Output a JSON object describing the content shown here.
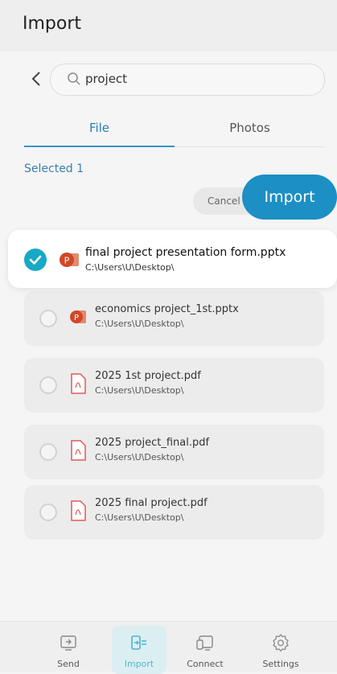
{
  "header": {
    "title": "Import"
  },
  "search": {
    "query": "project"
  },
  "tabs": [
    {
      "label": "File"
    },
    {
      "label": "Photos"
    }
  ],
  "selection": {
    "count_label": "Selected 1"
  },
  "actions": {
    "cancel_label": "Cancel",
    "import_label": "Import"
  },
  "files": [
    {
      "name": "final project presentation form.pptx",
      "path": "C:\\Users\\U\\Desktop\\",
      "type": "pptx",
      "selected": true
    },
    {
      "name": "economics project_1st.pptx",
      "path": "C:\\Users\\U\\Desktop\\",
      "type": "pptx",
      "selected": false
    },
    {
      "name": "2025 1st project.pdf",
      "path": "C:\\Users\\U\\Desktop\\",
      "type": "pdf",
      "selected": false
    },
    {
      "name": "2025 project_final.pdf",
      "path": "C:\\Users\\U\\Desktop\\",
      "type": "pdf",
      "selected": false
    },
    {
      "name": "2025 final project.pdf",
      "path": "C:\\Users\\U\\Desktop\\",
      "type": "pdf",
      "selected": false
    }
  ],
  "nav": [
    {
      "label": "Send",
      "icon": "send-icon"
    },
    {
      "label": "Import",
      "icon": "import-icon",
      "active": true
    },
    {
      "label": "Connect",
      "icon": "connect-icon"
    },
    {
      "label": "Settings",
      "icon": "gear-icon"
    }
  ],
  "colors": {
    "accent": "#1c8fc4",
    "check": "#17a9c5",
    "pptx": "#d24726",
    "pdf": "#e05a5a"
  }
}
